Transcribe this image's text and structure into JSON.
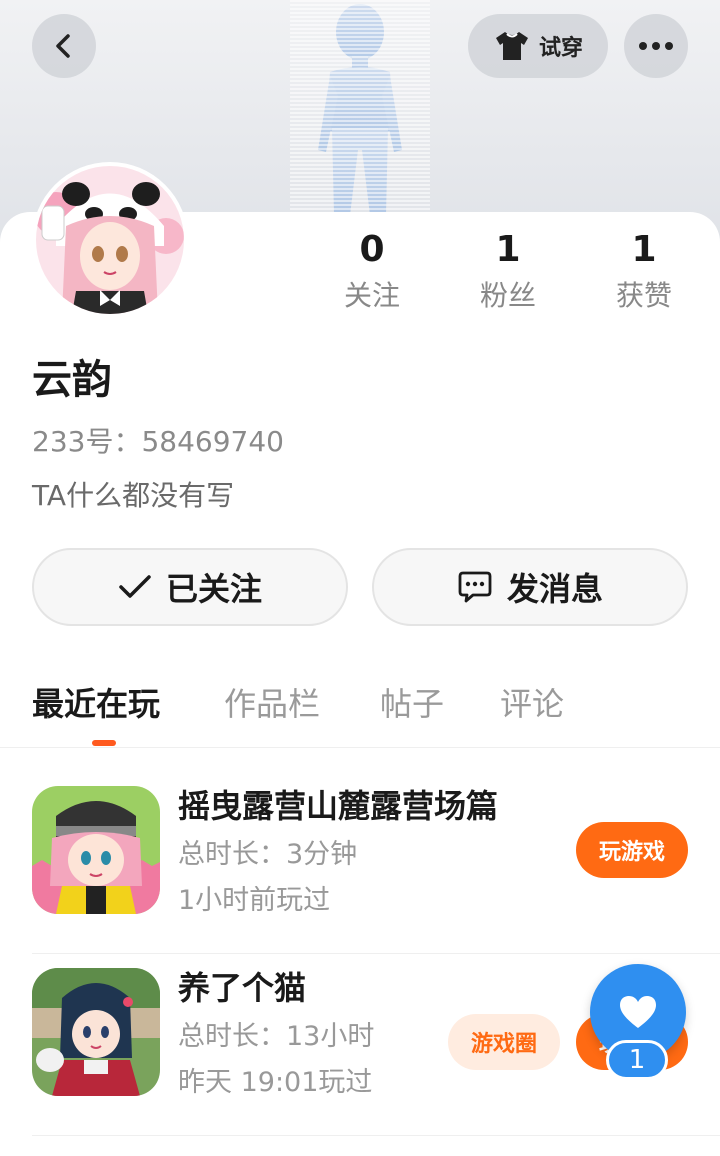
{
  "header": {
    "try_on_label": "试穿",
    "back_icon": "chevron-left-icon",
    "more_icon": "more-horizontal-icon",
    "try_on_icon": "tshirt-icon"
  },
  "profile": {
    "name": "云韵",
    "id_line": "233号：58469740",
    "bio": "TA什么都没有写",
    "stats": [
      {
        "value": "0",
        "label": "关注"
      },
      {
        "value": "1",
        "label": "粉丝"
      },
      {
        "value": "1",
        "label": "获赞"
      }
    ]
  },
  "actions": {
    "followed_label": "已关注",
    "message_label": "发消息"
  },
  "tabs": [
    {
      "label": "最近在玩",
      "active": true
    },
    {
      "label": "作品栏",
      "active": false
    },
    {
      "label": "帖子",
      "active": false
    },
    {
      "label": "评论",
      "active": false
    }
  ],
  "games": [
    {
      "title": "摇曳露营山麓露营场篇",
      "duration": "总时长：3分钟",
      "last_played": "1小时前玩过",
      "play_label": "玩游戏"
    },
    {
      "title": "养了个猫",
      "duration": "总时长：13小时",
      "last_played": "昨天 19:01玩过",
      "circle_label": "游戏圈",
      "play_label": "玩游戏"
    }
  ],
  "like_fab": {
    "count": "1",
    "icon": "heart-icon"
  },
  "colors": {
    "accent_orange": "#ff6a13",
    "tab_indicator": "#ff5a1f",
    "fab_blue": "#2f8ff0"
  }
}
